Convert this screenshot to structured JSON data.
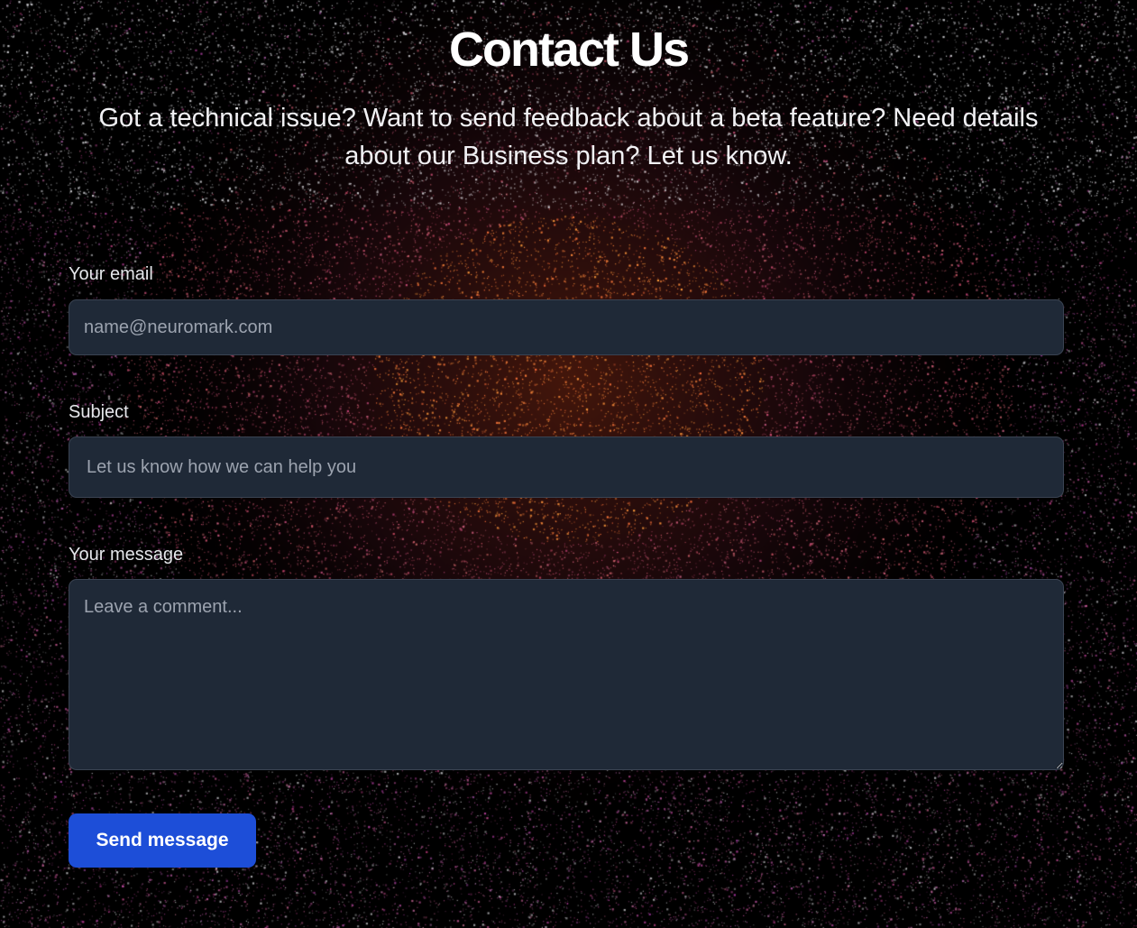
{
  "header": {
    "title": "Contact Us",
    "subtitle": "Got a technical issue? Want to send feedback about a beta feature? Need details about our Business plan? Let us know."
  },
  "form": {
    "email": {
      "label": "Your email",
      "placeholder": "name@neuromark.com",
      "value": ""
    },
    "subject": {
      "label": "Subject",
      "placeholder": "Let us know how we can help you",
      "value": ""
    },
    "message": {
      "label": "Your message",
      "placeholder": "Leave a comment...",
      "value": ""
    },
    "submit_label": "Send message"
  },
  "colors": {
    "background": "#000000",
    "field_background": "#1f2937",
    "field_border": "#3a4352",
    "button": "#1d4ed8",
    "glow_center": "#ff6a3d",
    "glow_edge": "#c2418a"
  }
}
